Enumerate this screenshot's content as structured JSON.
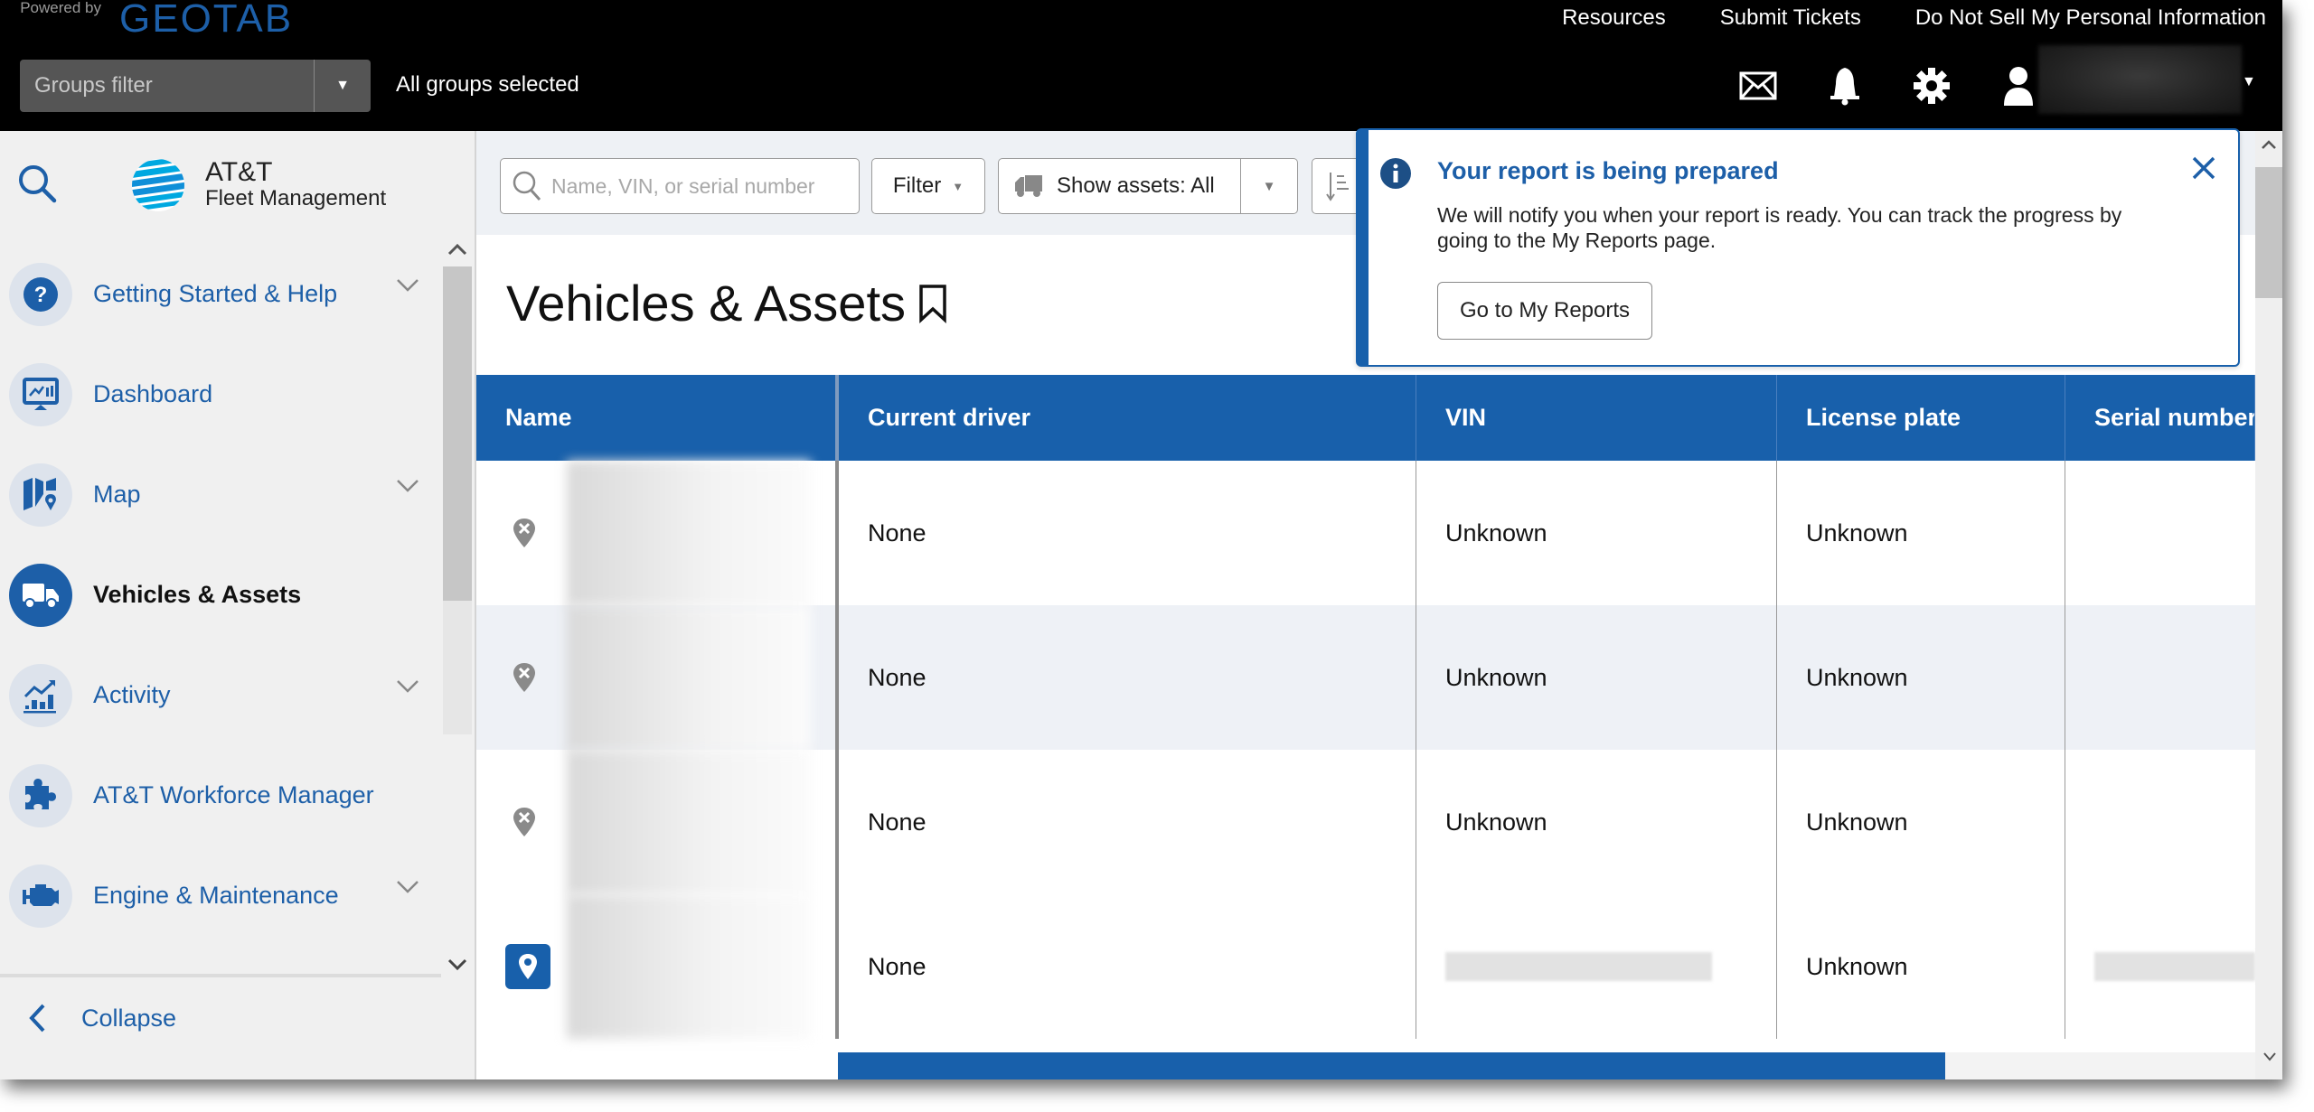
{
  "header": {
    "powered_by": "Powered by",
    "brand": "GEOTAB",
    "groups_filter_placeholder": "Groups filter",
    "groups_status": "All groups selected",
    "links": [
      "Resources",
      "Submit Tickets",
      "Do Not Sell My Personal Information"
    ],
    "icons": [
      "mail-icon",
      "bell-icon",
      "gear-icon",
      "user-icon"
    ]
  },
  "sidebar": {
    "logo_line1": "AT&T",
    "logo_line2": "Fleet Management",
    "items": [
      {
        "label": "Getting Started & Help",
        "icon": "help-icon",
        "expandable": true,
        "active": false
      },
      {
        "label": "Dashboard",
        "icon": "dashboard-icon",
        "expandable": false,
        "active": false
      },
      {
        "label": "Map",
        "icon": "map-icon",
        "expandable": true,
        "active": false
      },
      {
        "label": "Vehicles & Assets",
        "icon": "truck-icon",
        "expandable": false,
        "active": true
      },
      {
        "label": "Activity",
        "icon": "activity-icon",
        "expandable": true,
        "active": false
      },
      {
        "label": "AT&T Workforce Manager",
        "icon": "puzzle-icon",
        "expandable": false,
        "active": false
      },
      {
        "label": "Engine & Maintenance",
        "icon": "engine-icon",
        "expandable": true,
        "active": false
      }
    ],
    "collapse_label": "Collapse"
  },
  "toolbar": {
    "search_placeholder": "Name, VIN, or serial number",
    "filter_label": "Filter",
    "show_assets_label": "Show assets: All"
  },
  "page": {
    "title": "Vehicles & Assets"
  },
  "table": {
    "columns": [
      "Name",
      "Current driver",
      "VIN",
      "License plate",
      "Serial number"
    ],
    "rows": [
      {
        "status": "no-location",
        "driver": "None",
        "vin": "Unknown",
        "plate": "Unknown",
        "serial": ""
      },
      {
        "status": "no-location",
        "driver": "None",
        "vin": "Unknown",
        "plate": "Unknown",
        "serial": ""
      },
      {
        "status": "no-location",
        "driver": "None",
        "vin": "Unknown",
        "plate": "Unknown",
        "serial": ""
      },
      {
        "status": "located",
        "driver": "None",
        "vin": "",
        "plate": "Unknown",
        "serial": ""
      }
    ]
  },
  "notification": {
    "title": "Your report is being prepared",
    "message": "We will notify you when your report is ready. You can track the progress by going to the My Reports page.",
    "button_label": "Go to My Reports"
  },
  "colors": {
    "brand_blue": "#1860ab",
    "header_bg": "#000000",
    "sidebar_bg": "#f0f0f0"
  }
}
